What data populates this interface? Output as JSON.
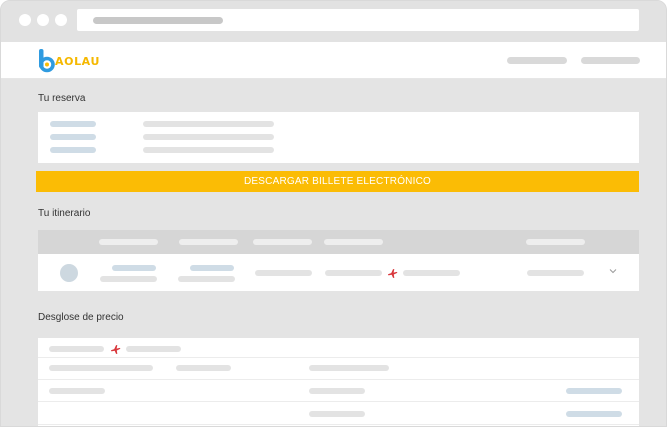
{
  "brand": {
    "logo_text": "AOLAU",
    "accent": "#fbbc05",
    "logo_blue": "#2f9be0"
  },
  "sections": {
    "reserva_title": "Tu reserva",
    "itinerario_title": "Tu itinerario",
    "desglose_title": "Desglose de precio"
  },
  "actions": {
    "download_label": "DESCARGAR BILLETE ELECTRÓNICO"
  },
  "icons": {
    "plane": "airplane-icon",
    "chevron": "chevron-down-icon"
  }
}
